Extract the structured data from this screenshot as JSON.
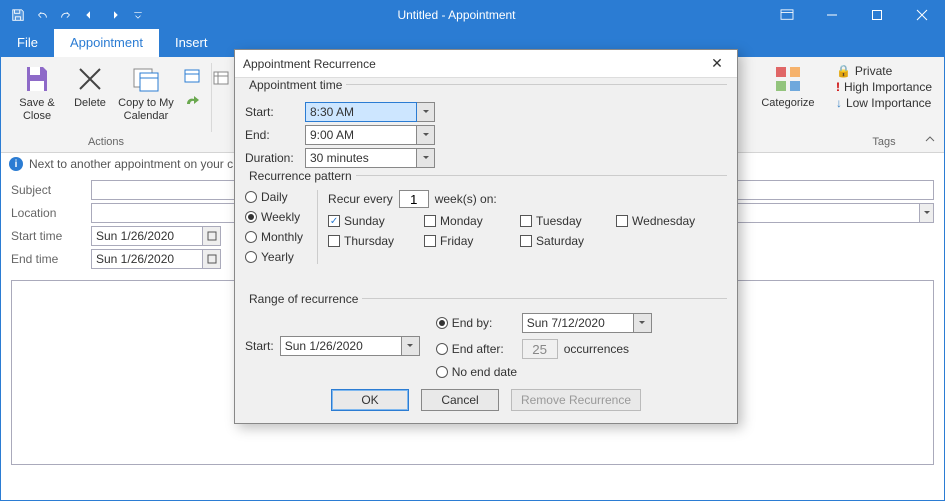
{
  "window_title": "Untitled  -  Appointment",
  "tabs": {
    "file": "File",
    "appointment": "Appointment",
    "insert": "Insert"
  },
  "ribbon": {
    "actions_group": "Actions",
    "save_close": "Save & Close",
    "delete": "Delete",
    "copy_cal": "Copy to My Calendar",
    "categorize": "Categorize",
    "private": "Private",
    "high_imp": "High Importance",
    "low_imp": "Low Importance",
    "tags_group": "Tags"
  },
  "infobar": "Next to another appointment on your c",
  "form": {
    "subject_label": "Subject",
    "location_label": "Location",
    "start_label": "Start time",
    "end_label": "End time",
    "start_value": "Sun 1/26/2020",
    "end_value": "Sun 1/26/2020"
  },
  "dialog": {
    "title": "Appointment Recurrence",
    "appt_time": "Appointment time",
    "start_label": "Start:",
    "start_value": "8:30 AM",
    "end_label": "End:",
    "end_value": "9:00 AM",
    "duration_label": "Duration:",
    "duration_value": "30 minutes",
    "pattern_title": "Recurrence pattern",
    "daily": "Daily",
    "weekly": "Weekly",
    "monthly": "Monthly",
    "yearly": "Yearly",
    "recur_every": "Recur every",
    "recur_num": "1",
    "weeks_on": "week(s) on:",
    "days": {
      "sun": "Sunday",
      "mon": "Monday",
      "tue": "Tuesday",
      "wed": "Wednesday",
      "thu": "Thursday",
      "fri": "Friday",
      "sat": "Saturday"
    },
    "range_title": "Range of recurrence",
    "range_start_label": "Start:",
    "range_start_value": "Sun 1/26/2020",
    "end_by": "End by:",
    "end_by_value": "Sun 7/12/2020",
    "end_after": "End after:",
    "end_after_num": "25",
    "occurrences": "occurrences",
    "no_end": "No end date",
    "ok": "OK",
    "cancel": "Cancel",
    "remove": "Remove Recurrence"
  }
}
